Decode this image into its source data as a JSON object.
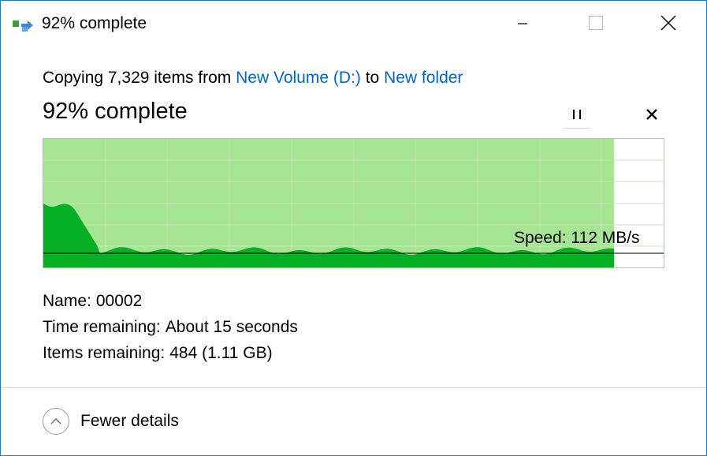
{
  "window": {
    "title": "92% complete",
    "icon": "file-copy-icon",
    "controls": [
      "minimize-icon",
      "maximize-icon",
      "close-icon"
    ]
  },
  "operation": {
    "prefix": "Copying 7,329 items from",
    "source": "New Volume (D:)",
    "to_word": "to",
    "destination": "New folder"
  },
  "status": "92% complete",
  "progress": {
    "fraction": 0.92
  },
  "buttons": {
    "pause": "pause-icon",
    "cancel": "cancel-icon"
  },
  "speed": {
    "label": "Speed: 112 MB/s"
  },
  "details": {
    "name_label": "Name:",
    "name_value": "00002",
    "time_label": "Time remaining:",
    "time_value": "About 15 seconds",
    "items_label": "Items remaining:",
    "items_value": "484 (1.11 GB)"
  },
  "footer": {
    "fewer_details": "Fewer details"
  },
  "colors": {
    "progress_fill": "#a6e593",
    "speed_fill": "#06b025",
    "grid": "#bfe8b3",
    "link": "#0066cc",
    "border": "#1979ca"
  }
}
